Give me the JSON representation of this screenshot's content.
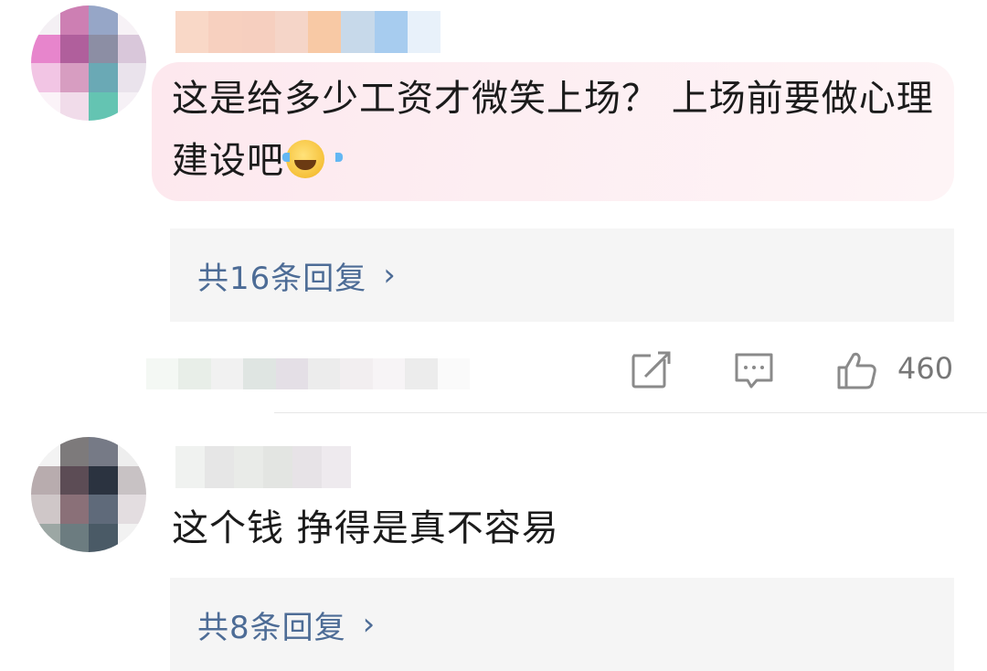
{
  "comments": [
    {
      "text": "这是给多少工资才微笑上场？ 上场前要做心理建设吧",
      "emoji_name": "laugh-cry-icon",
      "replies_label": "共16条回复",
      "reply_chevron": "›",
      "like_count": "460",
      "username_blurred": true,
      "avatar_blurred": true
    },
    {
      "text": "这个钱 挣得是真不容易",
      "replies_label": "共8条回复",
      "reply_chevron": "›",
      "username_blurred": true,
      "avatar_blurred": true
    }
  ],
  "icons": {
    "share": "share-icon",
    "reply": "comment-icon",
    "like": "thumbs-up-icon"
  },
  "colors": {
    "reply_link": "#4d6c96",
    "bubble_highlight": "#fde8ee",
    "reply_box_bg": "#f5f5f5",
    "icon_gray": "#8a8a8a"
  }
}
